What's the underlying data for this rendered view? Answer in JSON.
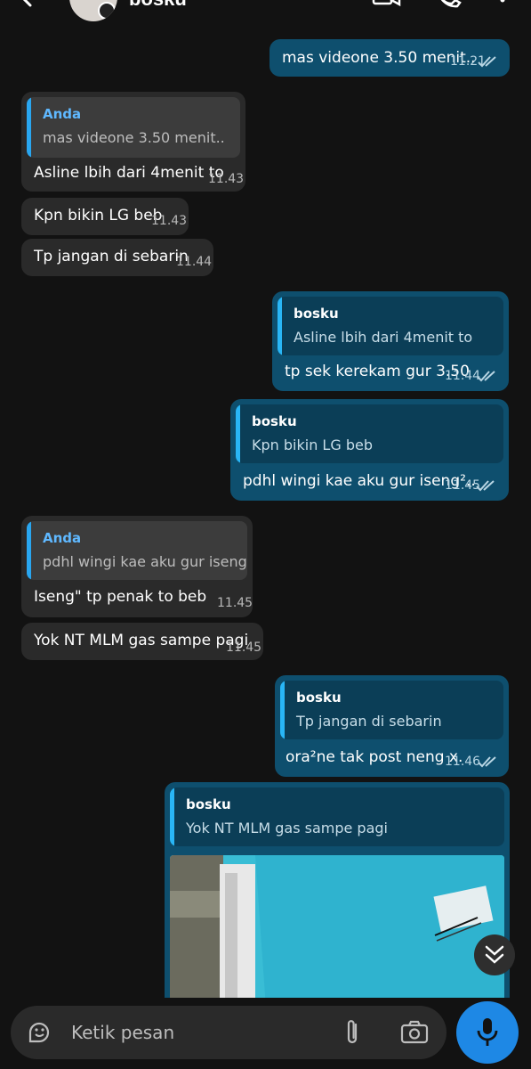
{
  "header": {
    "contact_name": "bosku",
    "icons": [
      "back-arrow-icon",
      "video-call-icon",
      "voice-call-icon",
      "more-options-icon"
    ]
  },
  "messages": [
    {
      "dir": "out",
      "text": "mas videone 3.50 menit..",
      "time": "11.21",
      "read": true
    },
    {
      "dir": "in",
      "reply_to_name": "Anda",
      "reply_to_text": "mas videone 3.50 menit..",
      "text": "Asline lbih dari 4menit to",
      "time": "11.43"
    },
    {
      "dir": "in",
      "text": "Kpn bikin LG beb",
      "time": "11.43"
    },
    {
      "dir": "in",
      "text": "Tp jangan di sebarin",
      "time": "11.44"
    },
    {
      "dir": "out",
      "reply_to_name": "bosku",
      "reply_to_text": "Asline lbih dari 4menit to",
      "text": "tp sek kerekam gur 3.50",
      "time": "11.44",
      "read": true
    },
    {
      "dir": "out",
      "reply_to_name": "bosku",
      "reply_to_text": "Kpn bikin LG beb",
      "text": "pdhl wingi kae aku gur iseng²..",
      "time": "11.45",
      "read": true
    },
    {
      "dir": "in",
      "reply_to_name": "Anda",
      "reply_to_text": "pdhl wingi kae aku gur iseng²..",
      "text": "Iseng\" tp penak to beb",
      "time": "11.45"
    },
    {
      "dir": "in",
      "text": "Yok NT MLM gas sampe pagi",
      "time": "11.45"
    },
    {
      "dir": "out",
      "reply_to_name": "bosku",
      "reply_to_text": "Tp jangan di sebarin",
      "text": "ora²ne tak post neng x.",
      "time": "11.46",
      "read": true
    },
    {
      "dir": "out",
      "reply_to_name": "bosku",
      "reply_to_text": "Yok NT MLM gas sampe pagi",
      "media": "photo"
    }
  ],
  "composer": {
    "placeholder": "Ketik pesan",
    "icons": [
      "sticker-icon",
      "attach-icon",
      "camera-icon",
      "microphone-icon"
    ]
  },
  "colors": {
    "background": "#121212",
    "outgoing_bubble": "#0e4f6e",
    "incoming_bubble": "#2a2a2a",
    "quote_bar": "#29b6f6",
    "mic_button": "#1e88e5"
  }
}
